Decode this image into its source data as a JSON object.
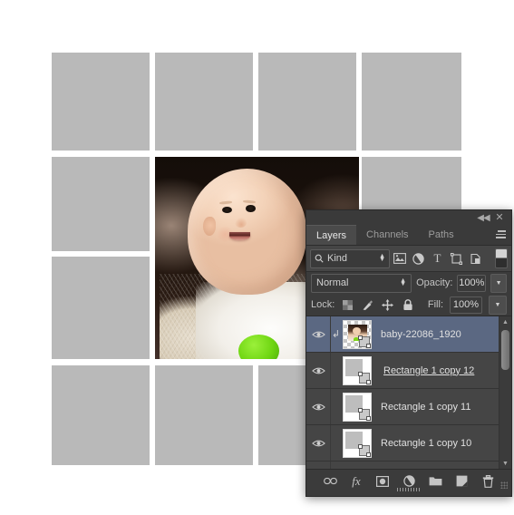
{
  "app": "Adobe Photoshop",
  "canvas": {
    "photo_layer_alt": "smiling baby photograph",
    "grid_cell_color": "#b9b9b9",
    "background_color": "#ffffff"
  },
  "panel": {
    "titlebar": {
      "collapse_label": "◀◀",
      "close_label": "✕"
    },
    "tabs": [
      {
        "label": "Layers",
        "active": true
      },
      {
        "label": "Channels",
        "active": false
      },
      {
        "label": "Paths",
        "active": false
      }
    ],
    "menu_icon": "panel-menu-icon",
    "filter": {
      "search_icon": "search-icon",
      "kind_label": "Kind",
      "icons": [
        {
          "name": "filter-pixel-icon",
          "glyph": "⛰"
        },
        {
          "name": "filter-adjustment-icon",
          "glyph": "◑"
        },
        {
          "name": "filter-type-icon",
          "glyph": "T"
        },
        {
          "name": "filter-shape-icon",
          "glyph": "⬚"
        },
        {
          "name": "filter-smartobject-icon",
          "glyph": "⧉"
        }
      ],
      "toggle_name": "filter-enable-toggle"
    },
    "blend": {
      "mode": "Normal",
      "opacity_label": "Opacity:",
      "opacity_value": "100%"
    },
    "lock": {
      "label": "Lock:",
      "icons": [
        {
          "name": "lock-transparent-pixels-icon"
        },
        {
          "name": "lock-image-pixels-icon"
        },
        {
          "name": "lock-position-icon"
        },
        {
          "name": "lock-all-icon"
        }
      ],
      "fill_label": "Fill:",
      "fill_value": "100%"
    },
    "layers": [
      {
        "name": "baby-22086_1920",
        "visible": true,
        "selected": true,
        "clipped": true,
        "thumb": "photo",
        "editing": false
      },
      {
        "name": "Rectangle 1 copy 12",
        "visible": true,
        "selected": false,
        "clipped": false,
        "thumb": "shape",
        "editing": true
      },
      {
        "name": "Rectangle 1 copy 11",
        "visible": true,
        "selected": false,
        "clipped": false,
        "thumb": "shape",
        "editing": false
      },
      {
        "name": "Rectangle 1 copy 10",
        "visible": true,
        "selected": false,
        "clipped": false,
        "thumb": "shape",
        "editing": false
      },
      {
        "name": "",
        "visible": false,
        "selected": false,
        "clipped": false,
        "thumb": "shape-wide",
        "editing": false
      }
    ],
    "scrollbar": {
      "up_glyph": "▲",
      "down_glyph": "▼"
    },
    "footer_buttons": [
      {
        "name": "link-layers-button",
        "glyph": "⧉"
      },
      {
        "name": "layer-style-fx-button",
        "glyph": "fx"
      },
      {
        "name": "add-layer-mask-button",
        "glyph": "▣"
      },
      {
        "name": "new-fill-adjustment-layer-button",
        "glyph": "◑"
      },
      {
        "name": "new-group-button",
        "glyph": "▰"
      },
      {
        "name": "new-layer-button",
        "glyph": "◥"
      },
      {
        "name": "delete-layer-button",
        "glyph": "Ὕ1"
      }
    ],
    "colors": {
      "panel_bg": "#3b3b3b",
      "list_bg": "#454545",
      "selected_row": "#5b6882",
      "text": "#d2d2d2"
    }
  }
}
